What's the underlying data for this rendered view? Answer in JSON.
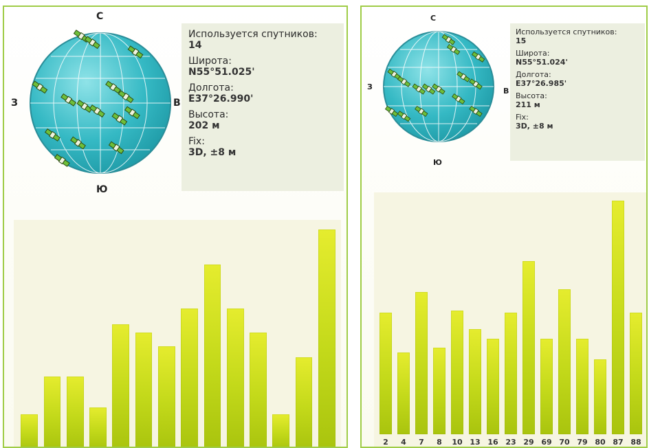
{
  "left": {
    "compass": {
      "north": "С",
      "south": "Ю",
      "west": "З",
      "east": "В"
    },
    "info": {
      "sats_label": "Используется спутников:",
      "sats_value": "14",
      "lat_label": "Широта:",
      "lat_value": "N55°51.025'",
      "lon_label": "Долгота:",
      "lon_value": "E37°26.990'",
      "alt_label": "Высота:",
      "alt_value": "202 м",
      "fix_label": "Fix:",
      "fix_value": "3D, ±8 м"
    },
    "chart_data": {
      "type": "bar",
      "categories": [
        "",
        "",
        "",
        "",
        "",
        "",
        "",
        "",
        "",
        "",
        "",
        "",
        "",
        "",
        ""
      ],
      "values": [
        16,
        33,
        33,
        19,
        57,
        53,
        47,
        64,
        84,
        64,
        53,
        16,
        42,
        100
      ],
      "ylim": [
        0,
        100
      ]
    },
    "satellites": [
      [
        0.38,
        0.08
      ],
      [
        0.45,
        0.12
      ],
      [
        0.72,
        0.18
      ],
      [
        0.12,
        0.4
      ],
      [
        0.3,
        0.48
      ],
      [
        0.4,
        0.52
      ],
      [
        0.48,
        0.55
      ],
      [
        0.58,
        0.4
      ],
      [
        0.66,
        0.46
      ],
      [
        0.7,
        0.56
      ],
      [
        0.62,
        0.6
      ],
      [
        0.2,
        0.7
      ],
      [
        0.36,
        0.75
      ],
      [
        0.6,
        0.78
      ],
      [
        0.26,
        0.86
      ]
    ]
  },
  "right": {
    "compass": {
      "north": "С",
      "south": "Ю",
      "west": "З",
      "east": "В"
    },
    "info": {
      "sats_label": "Используется спутников:",
      "sats_value": "15",
      "lat_label": "Широта:",
      "lat_value": "N55°51.024'",
      "lon_label": "Долгота:",
      "lon_value": "E37°26.985'",
      "alt_label": "Высота:",
      "alt_value": "211 м",
      "fix_label": "Fix:",
      "fix_value": "3D, ±8 м"
    },
    "chart_data": {
      "type": "bar",
      "categories": [
        "2",
        "4",
        "7",
        "8",
        "10",
        "13",
        "16",
        "23",
        "29",
        "69",
        "70",
        "79",
        "80",
        "87",
        "88"
      ],
      "values": [
        52,
        35,
        61,
        37,
        53,
        45,
        41,
        52,
        74,
        41,
        62,
        41,
        32,
        100,
        52
      ],
      "ylim": [
        0,
        100
      ]
    },
    "satellites": [
      [
        0.58,
        0.12
      ],
      [
        0.62,
        0.2
      ],
      [
        0.82,
        0.26
      ],
      [
        0.14,
        0.4
      ],
      [
        0.22,
        0.46
      ],
      [
        0.34,
        0.52
      ],
      [
        0.42,
        0.52
      ],
      [
        0.5,
        0.52
      ],
      [
        0.7,
        0.42
      ],
      [
        0.8,
        0.48
      ],
      [
        0.66,
        0.6
      ],
      [
        0.12,
        0.7
      ],
      [
        0.22,
        0.74
      ],
      [
        0.36,
        0.7
      ],
      [
        0.8,
        0.7
      ]
    ]
  }
}
